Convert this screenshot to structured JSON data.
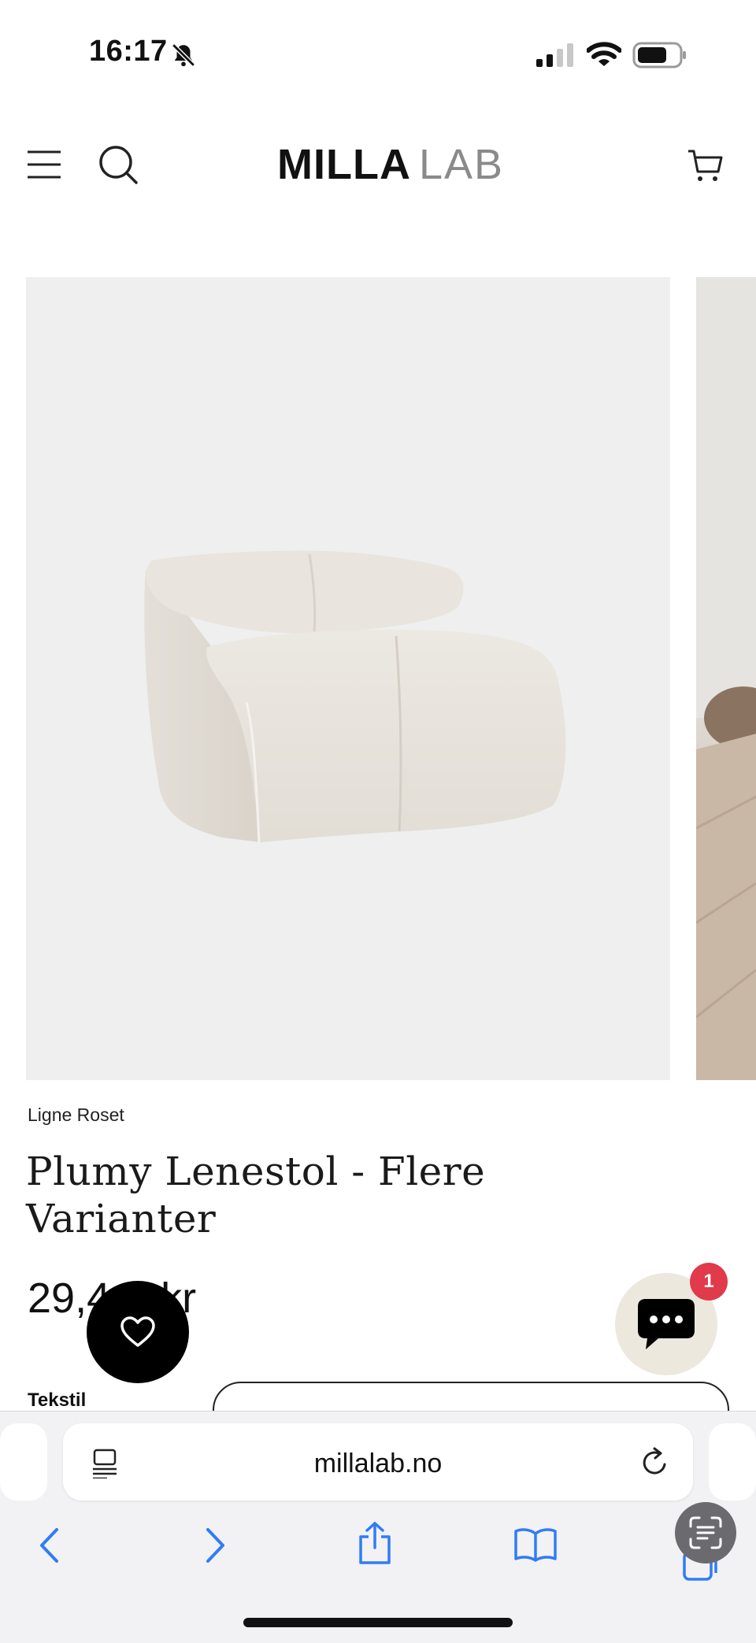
{
  "status_bar": {
    "time": "16:17",
    "icons": [
      "bell-slash-icon",
      "cellular-signal-icon",
      "wifi-icon",
      "battery-icon"
    ]
  },
  "header": {
    "logo_bold": "MILLA",
    "logo_light": "LAB",
    "icons": [
      "menu-icon",
      "search-icon",
      "cart-icon"
    ]
  },
  "product": {
    "brand": "Ligne Roset",
    "title": "Plumy Lenestol - Flere Varianter",
    "price": "29,4",
    "price_suffix": "kr",
    "option_label": "Tekstil"
  },
  "chat": {
    "badge_count": "1"
  },
  "browser": {
    "url": "millalab.no",
    "toolbar_icons": [
      "back-icon",
      "forward-icon",
      "share-icon",
      "bookmarks-icon",
      "tabs-icon"
    ]
  },
  "colors": {
    "badge": "#e03a4b",
    "browser_icons": "#2f7cf6",
    "chat_bubble": "#ece8dd"
  }
}
